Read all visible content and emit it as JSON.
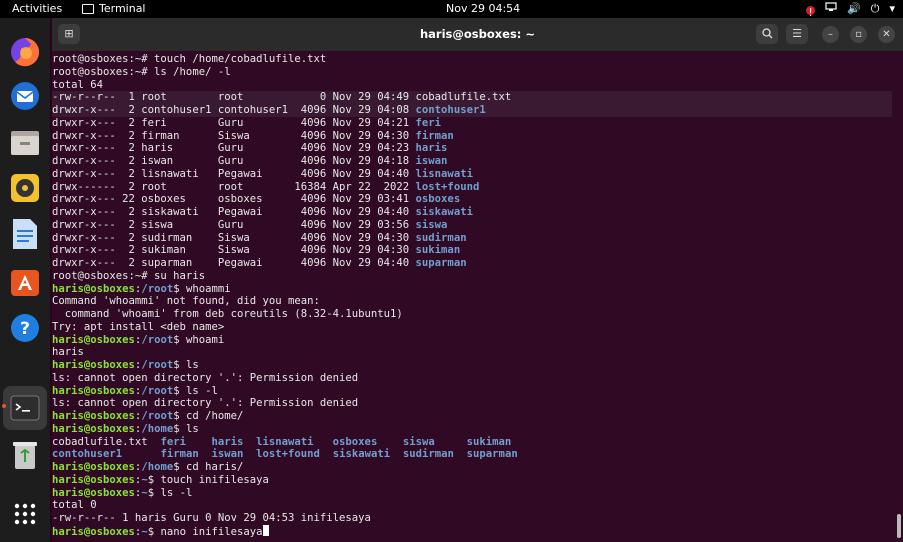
{
  "topbar": {
    "activities": "Activities",
    "app_name": "Terminal",
    "clock": "Nov 29  04:54",
    "tray": [
      "!",
      "🔊",
      "⏻",
      "▾"
    ]
  },
  "dock": {
    "items": [
      "firefox-icon",
      "thunderbird-icon",
      "files-icon",
      "rhythmbox-icon",
      "writer-icon",
      "software-icon",
      "help-icon",
      "terminal-icon",
      "trash-icon",
      "show-apps-icon"
    ]
  },
  "window": {
    "title": "haris@osboxes: ~",
    "new_tab_icon": "⊞",
    "search_icon": "⌕",
    "menu_icon": "☰",
    "minimize": "–",
    "maximize": "▫",
    "close": "✕"
  },
  "terminal": {
    "lines": [
      "root@osboxes:~# touch /home/cobadlufile.txt",
      "root@osboxes:~# ls /home/ -l",
      "total 64",
      "-rw-r--r--  1 root        root            0 Nov 29 04:49 cobadlufile.txt",
      "drwxr-x---  2 contohuser1 contohuser1  4096 Nov 29 04:08 contohuser1",
      "drwxr-x---  2 feri        Guru         4096 Nov 29 04:21 feri",
      "drwxr-x---  2 firman      Siswa        4096 Nov 29 04:30 firman",
      "drwxr-x---  2 haris       Guru         4096 Nov 29 04:23 haris",
      "drwxr-x---  2 iswan       Guru         4096 Nov 29 04:18 iswan",
      "drwxr-x---  2 lisnawati   Pegawai      4096 Nov 29 04:40 lisnawati",
      "drwx------  2 root        root        16384 Apr 22  2022 lost+found",
      "drwxr-x--- 22 osboxes     osboxes      4096 Nov 29 03:41 osboxes",
      "drwxr-x---  2 siskawati   Pegawai      4096 Nov 29 04:40 siskawati",
      "drwxr-x---  2 siswa       Guru         4096 Nov 29 03:56 siswa",
      "drwxr-x---  2 sudirman    Siswa        4096 Nov 29 04:30 sudirman",
      "drwxr-x---  2 sukiman     Siswa        4096 Nov 29 04:30 sukiman",
      "drwxr-x---  2 suparman    Pegawai      4096 Nov 29 04:40 suparman",
      "root@osboxes:~# su haris",
      "haris@osboxes:/root$ whoammi",
      "Command 'whoammi' not found, did you mean:",
      "  command 'whoami' from deb coreutils (8.32-4.1ubuntu1)",
      "Try: apt install <deb name>",
      "haris@osboxes:/root$ whoami",
      "haris",
      "haris@osboxes:/root$ ls",
      "ls: cannot open directory '.': Permission denied",
      "haris@osboxes:/root$ ls -l",
      "ls: cannot open directory '.': Permission denied",
      "haris@osboxes:/root$ cd /home/",
      "haris@osboxes:/home$ ls",
      "cobadlufile.txt  feri    haris  lisnawati   osboxes    siswa     sukiman",
      "contohuser1      firman  iswan  lost+found  siskawati  sudirman  suparman",
      "haris@osboxes:/home$ cd haris/",
      "haris@osboxes:~$ touch inifilesaya",
      "haris@osboxes:~$ ls -l",
      "total 0",
      "-rw-r--r-- 1 haris Guru 0 Nov 29 04:53 inifilesaya",
      "haris@osboxes:~$ nano inifilesaya"
    ]
  }
}
